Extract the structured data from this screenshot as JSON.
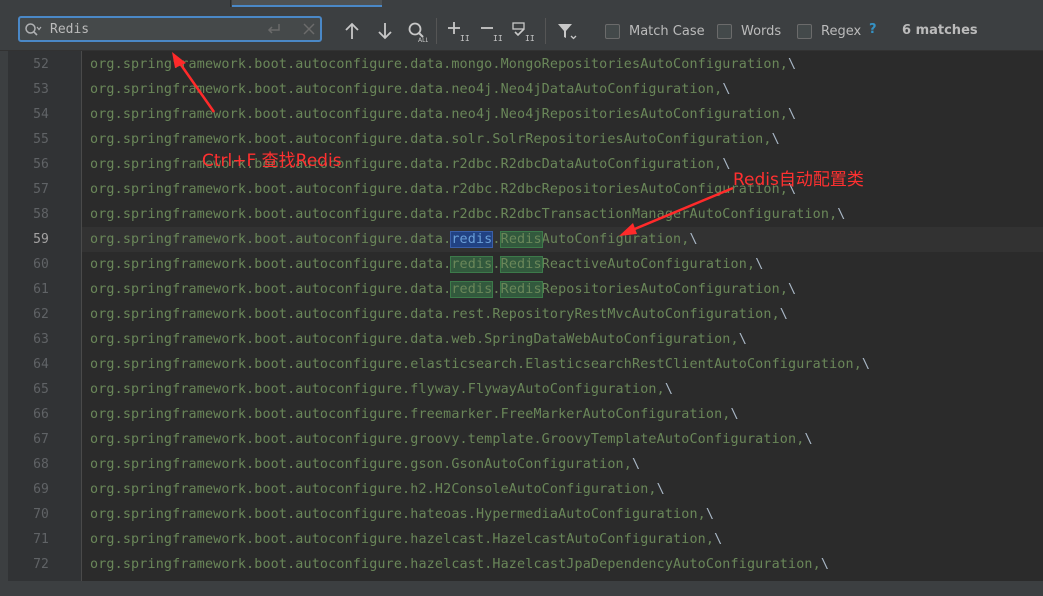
{
  "search": {
    "query": "Redis",
    "placeholder": ""
  },
  "toolbar": {
    "prev_icon": "arrow-up-icon",
    "next_icon": "arrow-down-icon",
    "find_all_icon": "find-all-icon",
    "add_selection_icon": "add-occurrence-icon",
    "remove_selection_icon": "remove-occurrence-icon",
    "select_all_icon": "select-all-occurrences-icon",
    "filter_icon": "filter-icon"
  },
  "options": {
    "match_case": "Match Case",
    "words": "Words",
    "regex": "Regex",
    "help": "?"
  },
  "match_count": "6 matches",
  "editor": {
    "lines": [
      {
        "num": "52",
        "pre": "org.springframework.boot.autoconfigure.data.mongo.MongoRepositoriesAutoConfiguration,",
        "tail": "\\"
      },
      {
        "num": "53",
        "pre": "org.springframework.boot.autoconfigure.data.neo4j.Neo4jDataAutoConfiguration,",
        "tail": "\\"
      },
      {
        "num": "54",
        "pre": "org.springframework.boot.autoconfigure.data.neo4j.Neo4jRepositoriesAutoConfiguration,",
        "tail": "\\"
      },
      {
        "num": "55",
        "pre": "org.springframework.boot.autoconfigure.data.solr.SolrRepositoriesAutoConfiguration,",
        "tail": "\\"
      },
      {
        "num": "56",
        "pre": "org.springframework.boot.autoconfigure.data.r2dbc.R2dbcDataAutoConfiguration,",
        "tail": "\\"
      },
      {
        "num": "57",
        "pre": "org.springframework.boot.autoconfigure.data.r2dbc.R2dbcRepositoriesAutoConfiguration,",
        "tail": "\\"
      },
      {
        "num": "58",
        "pre": "org.springframework.boot.autoconfigure.data.r2dbc.R2dbcTransactionManagerAutoConfiguration,",
        "tail": "\\"
      },
      {
        "num": "59",
        "pre": "org.springframework.boot.autoconfigure.data.",
        "m1": "redis",
        "mid": ".",
        "m2": "Redis",
        "post": "AutoConfiguration,",
        "tail": "\\",
        "current": true
      },
      {
        "num": "60",
        "pre": "org.springframework.boot.autoconfigure.data.",
        "m1": "redis",
        "mid": ".",
        "m2": "Redis",
        "post": "ReactiveAutoConfiguration,",
        "tail": "\\"
      },
      {
        "num": "61",
        "pre": "org.springframework.boot.autoconfigure.data.",
        "m1": "redis",
        "mid": ".",
        "m2": "Redis",
        "post": "RepositoriesAutoConfiguration,",
        "tail": "\\"
      },
      {
        "num": "62",
        "pre": "org.springframework.boot.autoconfigure.data.rest.RepositoryRestMvcAutoConfiguration,",
        "tail": "\\"
      },
      {
        "num": "63",
        "pre": "org.springframework.boot.autoconfigure.data.web.SpringDataWebAutoConfiguration,",
        "tail": "\\"
      },
      {
        "num": "64",
        "pre": "org.springframework.boot.autoconfigure.elasticsearch.ElasticsearchRestClientAutoConfiguration,",
        "tail": "\\"
      },
      {
        "num": "65",
        "pre": "org.springframework.boot.autoconfigure.flyway.FlywayAutoConfiguration,",
        "tail": "\\"
      },
      {
        "num": "66",
        "pre": "org.springframework.boot.autoconfigure.freemarker.FreeMarkerAutoConfiguration,",
        "tail": "\\"
      },
      {
        "num": "67",
        "pre": "org.springframework.boot.autoconfigure.groovy.template.GroovyTemplateAutoConfiguration,",
        "tail": "\\"
      },
      {
        "num": "68",
        "pre": "org.springframework.boot.autoconfigure.gson.GsonAutoConfiguration,",
        "tail": "\\"
      },
      {
        "num": "69",
        "pre": "org.springframework.boot.autoconfigure.h2.H2ConsoleAutoConfiguration,",
        "tail": "\\"
      },
      {
        "num": "70",
        "pre": "org.springframework.boot.autoconfigure.hateoas.HypermediaAutoConfiguration,",
        "tail": "\\"
      },
      {
        "num": "71",
        "pre": "org.springframework.boot.autoconfigure.hazelcast.HazelcastAutoConfiguration,",
        "tail": "\\"
      },
      {
        "num": "72",
        "pre": "org.springframework.boot.autoconfigure.hazelcast.HazelcastJpaDependencyAutoConfiguration,",
        "tail": "\\"
      }
    ]
  },
  "annotations": {
    "find_note": "Ctrl+F 查找Redis",
    "class_note": "Redis自动配置类",
    "color": "#ff3030"
  }
}
